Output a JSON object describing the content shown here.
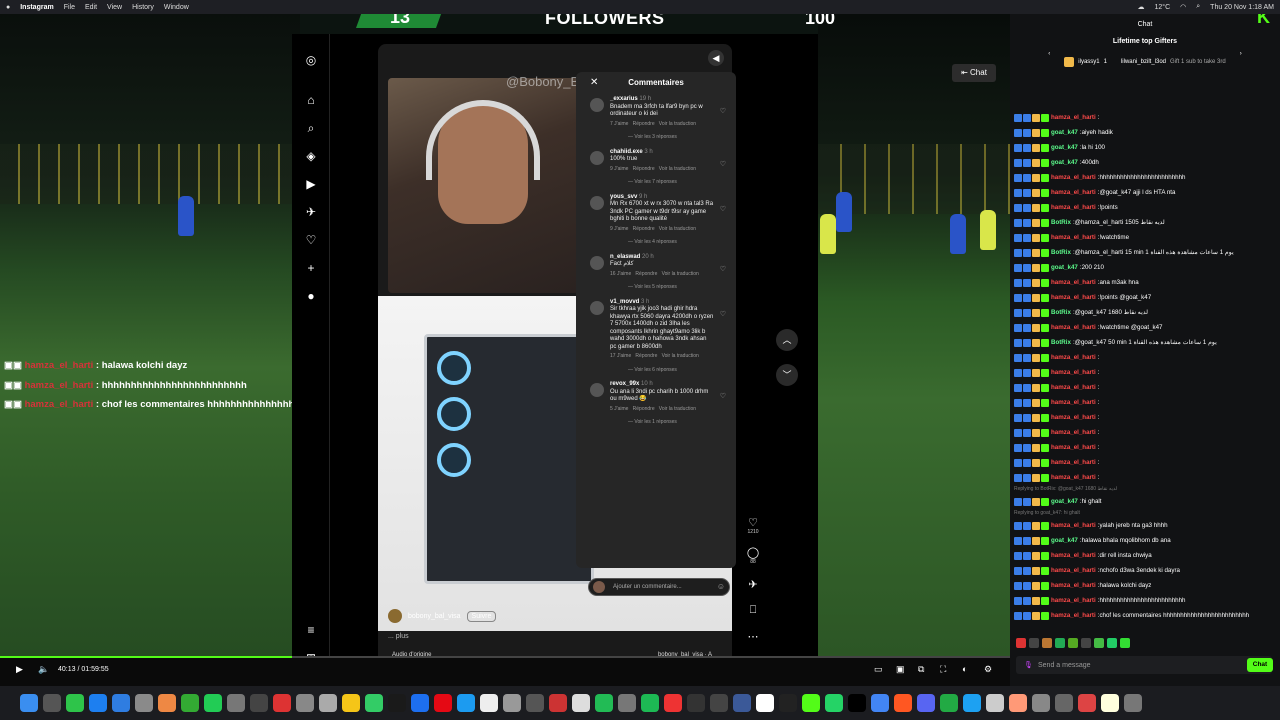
{
  "menubar": {
    "apple": "",
    "app": "Instagram",
    "menus": [
      "File",
      "Edit",
      "View",
      "History",
      "Window"
    ],
    "temp": "12°C",
    "clock": "Thu 20 Nov 1:18 AM"
  },
  "overlay": {
    "left_count": "13",
    "title": "FOLLOWERS",
    "right_count": "100"
  },
  "window": {
    "title": "Instagram"
  },
  "reel": {
    "watermark": "@Bobony_B",
    "username": "bobony_bal_visa",
    "follow": "Suivre",
    "caption": "... plus",
    "audio": "Audio d'origine",
    "audio_user": "bobony_bal_visa · A"
  },
  "comments": {
    "title": "Commentaires",
    "items": [
      {
        "user": "_exxarius",
        "time": "19 h",
        "text": "Bnadem ma 3rfch ta lfar9 byn pc w ordinateur o ki dei",
        "likes": "7 J'aime",
        "reply": "Répondre",
        "translate": "Voir la traduction",
        "replies": "Voir les 3 réponses"
      },
      {
        "user": "chahiid.exe",
        "time": "3 h",
        "text": "100% true",
        "likes": "9 J'aime",
        "reply": "Répondre",
        "translate": "Voir la traduction",
        "replies": "Voir les 7 réponses"
      },
      {
        "user": "yous_svv",
        "time": "9 h",
        "text": "Mn Rx 6700 xt w rx 3070 w nta tal3 Ra 3ndk PC gamer w t9dr t9sr ay game bghiti b bonne qualité",
        "likes": "9 J'aime",
        "reply": "Répondre",
        "translate": "Voir la traduction",
        "replies": "Voir les 4 réponses"
      },
      {
        "user": "n_elaswad",
        "time": "20 h",
        "text": "Fact كلام",
        "likes": "16 J'aime",
        "reply": "Répondre",
        "translate": "Voir la traduction",
        "replies": "Voir les 5 réponses"
      },
      {
        "user": "v1_movvd",
        "time": "3 h",
        "text": "Sir tkhraa yjik joo3 hadi ghir hdra khawya rtx 5060 dayra 4200dh o ryzen 7 5700x 1400dh o zid 3lha les composants lkhrin ghayt9amo 3lik b wahd 3000dh o hahowa 3ndk ahsan pc gamer b 8600dh",
        "likes": "17 J'aime",
        "reply": "Répondre",
        "translate": "Voir la traduction",
        "replies": "Voir les 6 réponses"
      },
      {
        "user": "revox_99x",
        "time": "10 h",
        "text": "Ou ana li 3ndi pc charih b 1000 drhm ou m9wed 😂",
        "likes": "5 J'aime",
        "reply": "Répondre",
        "translate": "Voir la traduction",
        "replies": "Voir les 1 réponses"
      }
    ],
    "placeholder": "Ajouter un commentaire..."
  },
  "reel_actions": {
    "likes": "1210",
    "comments": "88"
  },
  "stream_overlay": [
    {
      "name": "hamza_el_harti",
      "text": ": halawa kolchi dayz"
    },
    {
      "name": "hamza_el_harti",
      "text": ": hhhhhhhhhhhhhhhhhhhhhhhhh"
    },
    {
      "name": "hamza_el_harti",
      "text": ": chof les commentaires hhhhhhhhhhhhhhhhhhhhhhhhh"
    }
  ],
  "player": {
    "time": "40:13 / 01:59:55",
    "chat_button": "Chat"
  },
  "chat": {
    "title": "Chat",
    "lifetime": "Lifetime top Gifters",
    "gifter1": {
      "name": "ilyassy1",
      "count": "1"
    },
    "gifter2": {
      "name": "lilwani_bzilt_l3od",
      "sub": "Gift 1 sub to take 3rd"
    },
    "colors": {
      "red": "#ff4a4a",
      "green": "#5cfc8c",
      "white": "#ffffff"
    },
    "messages": [
      {
        "name": "hamza_el_harti",
        "text": "",
        "color": "red"
      },
      {
        "name": "goat_k47",
        "text": "aiyeh hadik",
        "color": "green"
      },
      {
        "name": "goat_k47",
        "text": "la hi 100",
        "color": "green"
      },
      {
        "name": "goat_k47",
        "text": "400dh",
        "color": "green"
      },
      {
        "name": "hamza_el_harti",
        "text": "hhhhhhhhhhhhhhhhhhhhhhhhh",
        "color": "red"
      },
      {
        "name": "hamza_el_harti",
        "text": "@goat_k47 ajji l ds HTA nta",
        "color": "red"
      },
      {
        "name": "hamza_el_harti",
        "text": "!points",
        "color": "red"
      },
      {
        "name": "BotRix",
        "text": "@hamza_el_harti 1505 لديه نقاط",
        "color": "green"
      },
      {
        "name": "hamza_el_harti",
        "text": "!watchtime",
        "color": "red"
      },
      {
        "name": "BotRix",
        "text": "@hamza_el_harti 15 min 1 يوم 1 ساعات مشاهدة هذه القناة",
        "color": "green"
      },
      {
        "name": "goat_k47",
        "text": "200 210",
        "color": "green"
      },
      {
        "name": "hamza_el_harti",
        "text": "ana m3ak hna",
        "color": "red"
      },
      {
        "name": "hamza_el_harti",
        "text": "!points @goat_k47",
        "color": "red"
      },
      {
        "name": "BotRix",
        "text": "@goat_k47 1680 لديه نقاط",
        "color": "green"
      },
      {
        "name": "hamza_el_harti",
        "text": "!watchtime @goat_k47",
        "color": "red"
      },
      {
        "name": "BotRix",
        "text": "@goat_k47 50 min 1 يوم 1 ساعات مشاهدة هذه القناة",
        "color": "green"
      },
      {
        "name": "hamza_el_harti",
        "text": "",
        "color": "red"
      },
      {
        "name": "hamza_el_harti",
        "text": "",
        "color": "red"
      },
      {
        "name": "hamza_el_harti",
        "text": "",
        "color": "red"
      },
      {
        "name": "hamza_el_harti",
        "text": "",
        "color": "red"
      },
      {
        "name": "hamza_el_harti",
        "text": "",
        "color": "red"
      },
      {
        "name": "hamza_el_harti",
        "text": "",
        "color": "red"
      },
      {
        "name": "hamza_el_harti",
        "text": "",
        "color": "red"
      },
      {
        "name": "hamza_el_harti",
        "text": "",
        "color": "red"
      },
      {
        "name": "hamza_el_harti",
        "text": "",
        "color": "red"
      }
    ],
    "reply1": "Replying to BotRix: @goat_k47 1680 لديه نقاط",
    "msg_after1": {
      "name": "goat_k47",
      "text": "hi ghalt"
    },
    "reply2": "Replying to goat_k47: hi ghalt",
    "tail": [
      {
        "name": "hamza_el_harti",
        "text": "yalah jereb nta ga3 hhhh",
        "color": "red"
      },
      {
        "name": "goat_k47",
        "text": "halawa bhala mqolibhom db ana",
        "color": "green"
      },
      {
        "name": "hamza_el_harti",
        "text": "dir rell insta chwiya",
        "color": "red"
      },
      {
        "name": "hamza_el_harti",
        "text": "nchofo d3wa 3endek ki dayra",
        "color": "red"
      },
      {
        "name": "hamza_el_harti",
        "text": "halawa kolchi dayz",
        "color": "red"
      },
      {
        "name": "hamza_el_harti",
        "text": "hhhhhhhhhhhhhhhhhhhhhhhhh",
        "color": "red"
      },
      {
        "name": "hamza_el_harti",
        "text": "chof les commentaires hhhhhhhhhhhhhhhhhhhhhhhhh",
        "color": "red"
      }
    ],
    "input_placeholder": "Send a message",
    "send": "Chat"
  }
}
